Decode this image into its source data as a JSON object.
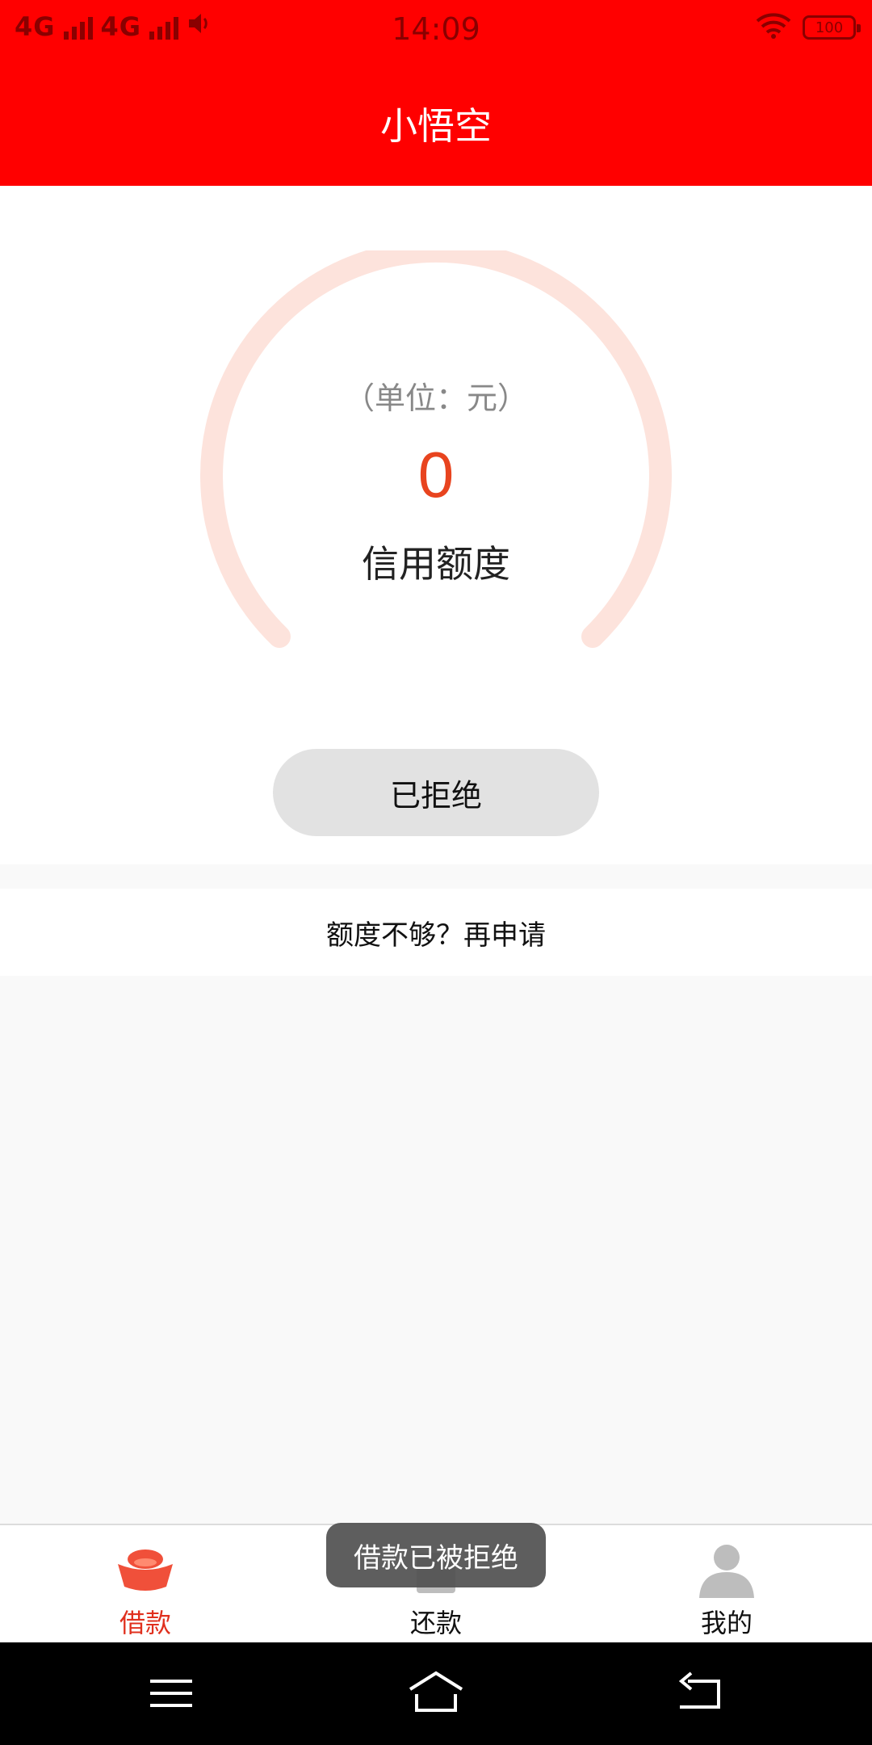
{
  "status_bar": {
    "network_1": "4G",
    "network_2": "4G",
    "time": "14:09",
    "battery": "100"
  },
  "header": {
    "title": "小悟空"
  },
  "credit": {
    "unit_label": "（单位：元）",
    "amount": "0",
    "label": "信用额度"
  },
  "status_button": {
    "label": "已拒绝"
  },
  "reapply": {
    "label": "额度不够？再申请"
  },
  "tabs": [
    {
      "label": "借款",
      "icon": "gold-ingot-icon",
      "active": true
    },
    {
      "label": "还款",
      "icon": "repay-icon",
      "active": false
    },
    {
      "label": "我的",
      "icon": "user-icon",
      "active": false
    }
  ],
  "toast": {
    "message": "借款已被拒绝"
  },
  "colors": {
    "brand": "#ff0000",
    "accent": "#e8441f",
    "gauge_track": "#fde3dc"
  }
}
